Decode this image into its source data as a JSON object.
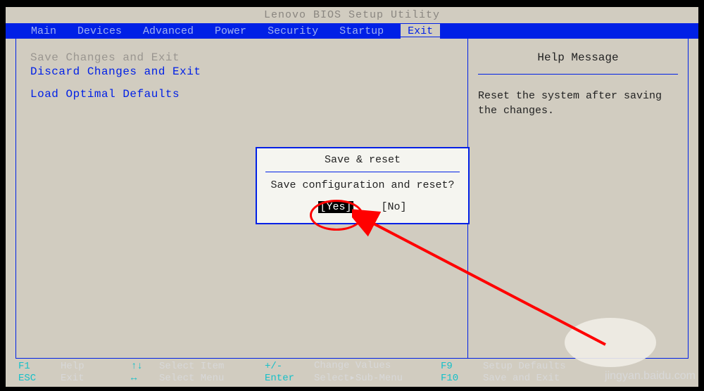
{
  "title": "Lenovo BIOS Setup Utility",
  "menubar": {
    "items": [
      "Main",
      "Devices",
      "Advanced",
      "Power",
      "Security",
      "Startup",
      "Exit"
    ],
    "active_index": 6
  },
  "left_panel": {
    "options": [
      {
        "label": "Save Changes and Exit",
        "enabled": false
      },
      {
        "label": "Discard Changes and Exit",
        "enabled": true
      },
      {
        "label": "Load Optimal Defaults",
        "enabled": true
      }
    ]
  },
  "right_panel": {
    "title": "Help Message",
    "text": "Reset the system after saving the changes."
  },
  "dialog": {
    "title": "Save & reset",
    "message": "Save configuration and reset?",
    "yes": "[Yes]",
    "no": "[No]",
    "selected": 0
  },
  "footer": {
    "f1_key": "F1",
    "f1_label": "Help",
    "esc_key": "ESC",
    "esc_label": "Exit",
    "arrows_v": "↑↓",
    "select_item": "Select Item",
    "arrows_h": "↔",
    "select_menu": "Select Menu",
    "pm_key": "+/-",
    "change_values": "Change Values",
    "enter_key": "Enter",
    "sub_menu": "Select▸Sub-Menu",
    "f9_key": "F9",
    "f9_label": "Setup Defaults",
    "f10_key": "F10",
    "f10_label": "Save and Exit"
  },
  "watermark": "jingyan.baidu.com"
}
